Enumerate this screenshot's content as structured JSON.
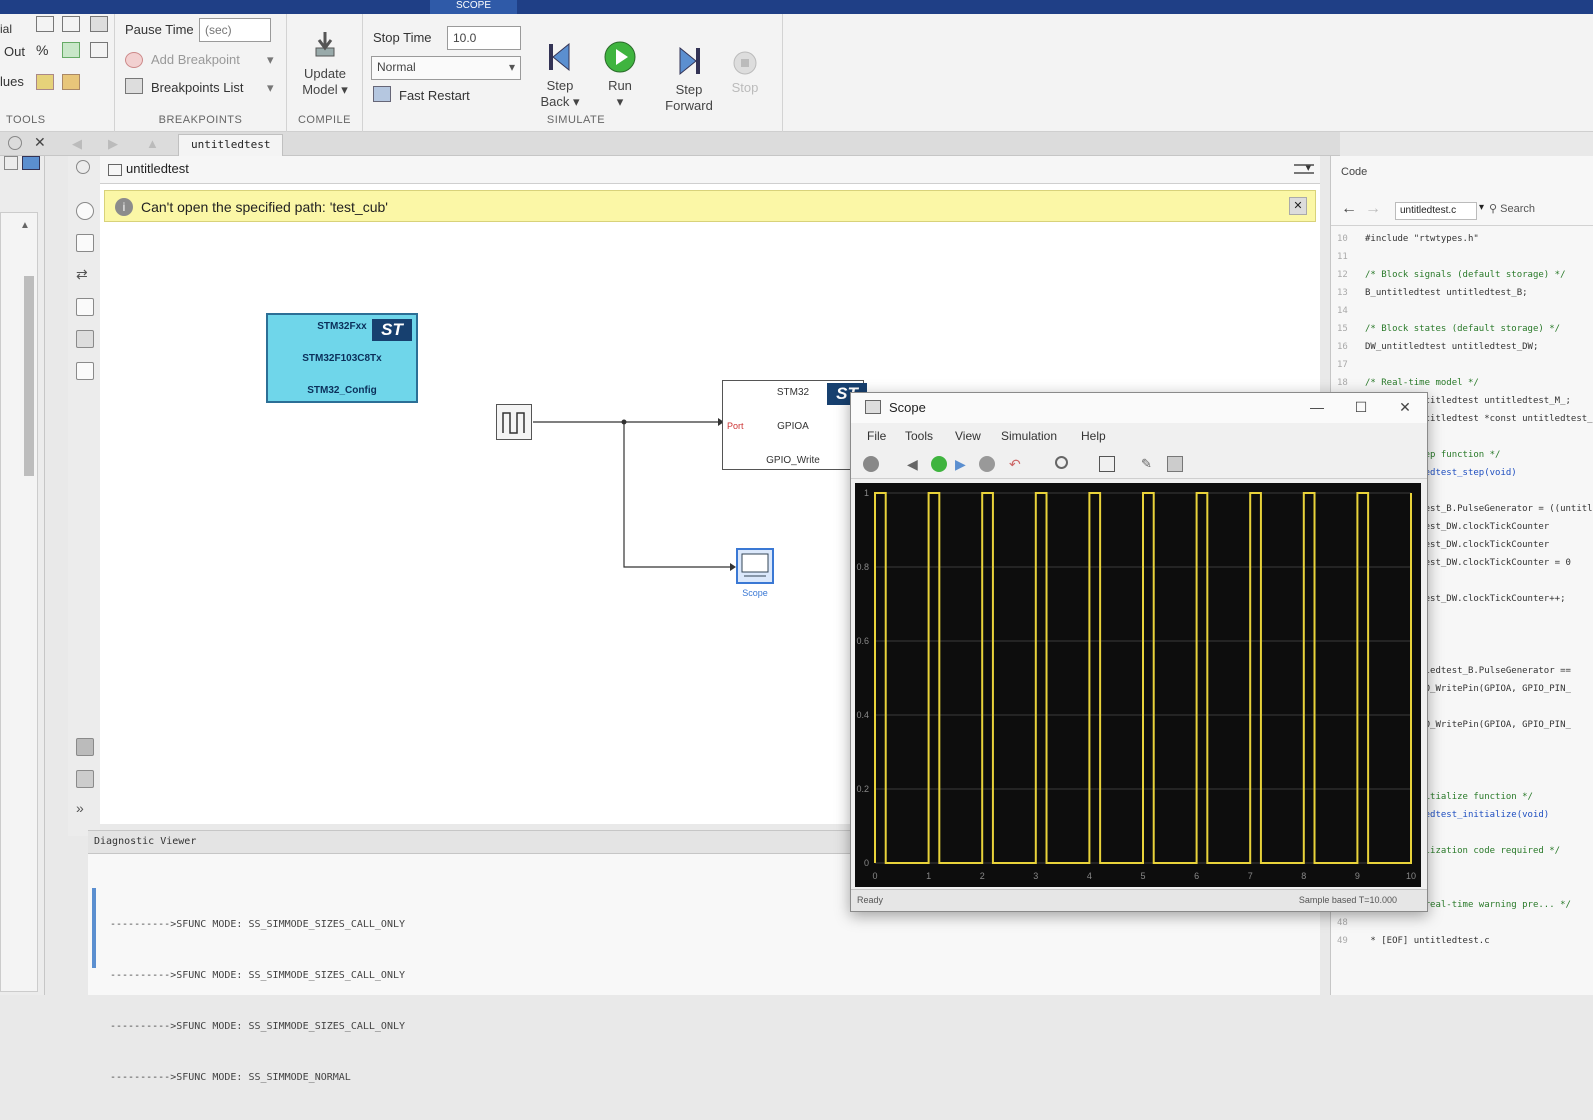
{
  "window_tabs": [
    "SCOPE"
  ],
  "ribbon": {
    "left_labels": [
      "ial",
      "Out",
      "lues"
    ],
    "tools_label": "TOOLS",
    "pause_time_label": "Pause Time",
    "pause_time_placeholder": "(sec)",
    "add_breakpoint": "Add Breakpoint",
    "breakpoints_list": "Breakpoints List",
    "breakpoints_label": "BREAKPOINTS",
    "update_model": "Update Model",
    "compile_label": "COMPILE",
    "stop_time_label": "Stop Time",
    "stop_time_value": "10.0",
    "sim_mode": "Normal",
    "fast_restart": "Fast Restart",
    "step_back": "Step Back",
    "run": "Run",
    "step_forward": "Step Forward",
    "stop": "Stop",
    "simulate_label": "SIMULATE"
  },
  "doc_tab": "untitledtest",
  "breadcrumb": "untitledtest",
  "warning": "Can't open the specified path: 'test_cub'",
  "blocks": {
    "config": {
      "line1": "STM32Fxx",
      "line2": "STM32F103C8Tx",
      "line3": "STM32_Config",
      "logo": "ST"
    },
    "gpio": {
      "line1": "STM32",
      "port": "Port",
      "line2": "GPIOA",
      "line3": "GPIO_Write",
      "logo": "ST"
    },
    "scope_label": "Scope"
  },
  "diagnostic": {
    "title": "Diagnostic Viewer",
    "lines": [
      "---------->SFUNC MODE: SS_SIMMODE_SIZES_CALL_ONLY",
      "---------->SFUNC MODE: SS_SIMMODE_SIZES_CALL_ONLY",
      "---------->SFUNC MODE: SS_SIMMODE_SIZES_CALL_ONLY",
      "---------->SFUNC MODE: SS_SIMMODE_NORMAL"
    ]
  },
  "code_panel": {
    "title": "Code",
    "file": "untitledtest.c",
    "search": "Search",
    "lines": [
      {
        "n": "10",
        "t": "#include \"rtwtypes.h\"",
        "k": ""
      },
      {
        "n": "11",
        "t": "",
        "k": ""
      },
      {
        "n": "12",
        "t": "/* Block signals (default storage) */",
        "k": "cm"
      },
      {
        "n": "13",
        "t": "B_untitledtest untitledtest_B;",
        "k": ""
      },
      {
        "n": "14",
        "t": "",
        "k": ""
      },
      {
        "n": "15",
        "t": "/* Block states (default storage) */",
        "k": "cm"
      },
      {
        "n": "16",
        "t": "DW_untitledtest untitledtest_DW;",
        "k": ""
      },
      {
        "n": "17",
        "t": "",
        "k": ""
      },
      {
        "n": "18",
        "t": "/* Real-time model */",
        "k": "cm"
      },
      {
        "n": "19",
        "t": "RT_MODEL_untitledtest untitledtest_M_;",
        "k": ""
      },
      {
        "n": "20",
        "t": "RT_MODEL_untitledtest *const untitledtest_M;",
        "k": ""
      },
      {
        "n": "21",
        "t": "",
        "k": ""
      },
      {
        "n": "22",
        "t": "/* Model step function */",
        "k": "cm"
      },
      {
        "n": "23",
        "t": "void untitledtest_step(void)",
        "k": "fn"
      },
      {
        "n": "24",
        "t": "{",
        "k": ""
      },
      {
        "n": "25",
        "t": "  untitledtest_B.PulseGenerator = ((untitledtest",
        "k": ""
      },
      {
        "n": "26",
        "t": "  untitledtest_DW.clockTickCounter",
        "k": ""
      },
      {
        "n": "27",
        "t": "  untitledtest_DW.clockTickCounter",
        "k": ""
      },
      {
        "n": "28",
        "t": "  untitledtest_DW.clockTickCounter = 0",
        "k": ""
      },
      {
        "n": "29",
        "t": "",
        "k": ""
      },
      {
        "n": "30",
        "t": "  untitledtest_DW.clockTickCounter++;",
        "k": ""
      },
      {
        "n": "31",
        "t": "",
        "k": ""
      },
      {
        "n": "32",
        "t": "",
        "k": ""
      },
      {
        "n": "33",
        "t": "",
        "k": ""
      },
      {
        "n": "34",
        "t": "  if (untitledtest_B.PulseGenerator ==",
        "k": ""
      },
      {
        "n": "35",
        "t": "    HAL_GPIO_WritePin(GPIOA, GPIO_PIN_",
        "k": ""
      },
      {
        "n": "36",
        "t": "",
        "k": ""
      },
      {
        "n": "37",
        "t": "    HAL_GPIO_WritePin(GPIOA, GPIO_PIN_",
        "k": ""
      },
      {
        "n": "38",
        "t": "",
        "k": ""
      },
      {
        "n": "39",
        "t": "",
        "k": ""
      },
      {
        "n": "40",
        "t": "",
        "k": ""
      },
      {
        "n": "41",
        "t": "/* Model initialize function */",
        "k": "cm"
      },
      {
        "n": "42",
        "t": "void untitledtest_initialize(void)",
        "k": "fn"
      },
      {
        "n": "43",
        "t": "",
        "k": ""
      },
      {
        "n": "44",
        "t": "  /* Initialization code required */",
        "k": "cm"
      },
      {
        "n": "45",
        "t": "",
        "k": ""
      },
      {
        "n": "46",
        "t": "",
        "k": ""
      },
      {
        "n": "47",
        "t": "/* ... for real-time warning pre... */",
        "k": "cm"
      },
      {
        "n": "48",
        "t": "",
        "k": ""
      },
      {
        "n": "49",
        "t": " * [EOF] untitledtest.c",
        "k": ""
      }
    ]
  },
  "scope": {
    "title": "Scope",
    "menu": [
      "File",
      "Tools",
      "View",
      "Simulation",
      "Help"
    ],
    "status_left": "Ready",
    "status_right": "Sample based  T=10.000",
    "plot": {
      "background": "#0d0d0d",
      "trace_color": "#e8d23a",
      "grid_color": "#3a3a3a",
      "x_ticks": [
        "0",
        "1",
        "2",
        "3",
        "4",
        "5",
        "6",
        "7",
        "8",
        "9",
        "10"
      ],
      "y_ticks": [
        "1",
        "0.8",
        "0.6",
        "0.4",
        "0.2",
        "0"
      ],
      "period": 1,
      "duty": 0.2,
      "xlim": [
        0,
        10
      ],
      "ylim": [
        0,
        1
      ]
    }
  }
}
